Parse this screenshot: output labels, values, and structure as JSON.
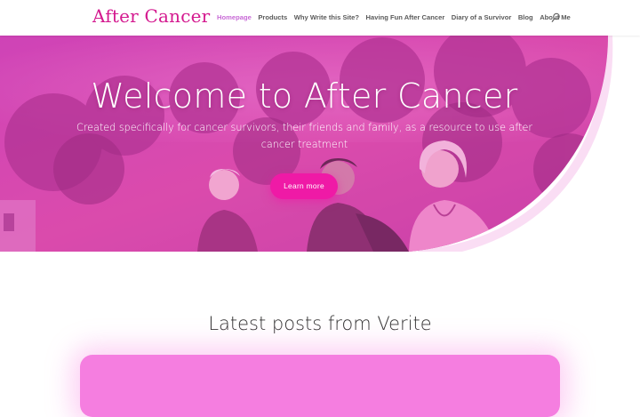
{
  "header": {
    "logo": "After Cancer",
    "nav": [
      {
        "label": "Homepage",
        "active": true
      },
      {
        "label": "Products",
        "active": false
      },
      {
        "label": "Why Write this Site?",
        "active": false
      },
      {
        "label": "Having Fun After Cancer",
        "active": false
      },
      {
        "label": "Diary of a Survivor",
        "active": false
      },
      {
        "label": "Blog",
        "active": false
      },
      {
        "label": "About Me",
        "active": false
      }
    ],
    "search_icon": "search-icon"
  },
  "hero": {
    "title": "Welcome to After Cancer",
    "subtitle": "Created specifically for cancer survivors, their friends and family, as a resource to use after cancer treatment",
    "button_label": "Learn more"
  },
  "latest": {
    "title": "Latest posts from Verite"
  },
  "colors": {
    "brand": "#d4198f",
    "accent": "#ef1aa6",
    "nav_active": "#c86ad6",
    "card": "#f57ee0"
  }
}
